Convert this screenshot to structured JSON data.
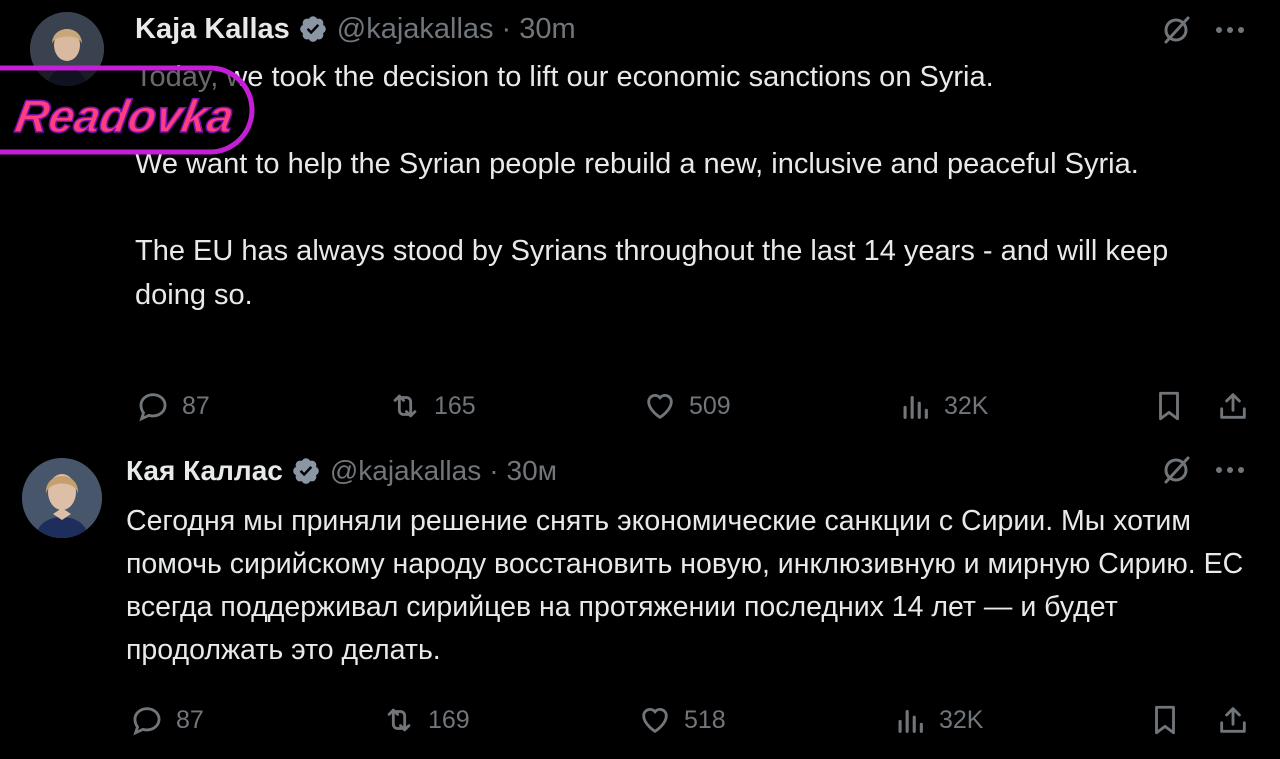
{
  "tweets": [
    {
      "author_name": "Kaja Kallas",
      "handle": "@kajakallas",
      "separator": "·",
      "time": "30m",
      "text": "Today, we took the decision to lift our economic sanctions on Syria.\n\nWe want to help the Syrian people rebuild a new, inclusive and peaceful Syria.\n\nThe EU has always stood by Syrians throughout the last 14 years - and will keep doing so.",
      "replies": "87",
      "reposts": "165",
      "likes": "509",
      "views": "32K"
    },
    {
      "author_name": "Кая Каллас",
      "handle": "@kajakallas",
      "separator": "·",
      "time": "30м",
      "text": "Сегодня мы приняли решение снять экономические санкции с Сирии. Мы хотим помочь сирийскому народу восстановить новую, инклюзивную и мирную Сирию. ЕС всегда поддерживал сирийцев на протяжении последних 14 лет — и будет продолжать это делать.",
      "replies": "87",
      "reposts": "169",
      "likes": "518",
      "views": "32K"
    }
  ],
  "watermark": {
    "text": "Readovka",
    "colors": {
      "border": "#c41ed6",
      "text": "#ff3d7f"
    }
  },
  "colors": {
    "background": "#000000",
    "text_primary": "#e7e9ea",
    "text_secondary": "#71767b",
    "verified_badge": "#1d9bf0"
  },
  "icons": [
    "verified-badge-icon",
    "grok-icon",
    "more-icon",
    "reply-icon",
    "repost-icon",
    "like-icon",
    "views-icon",
    "bookmark-icon",
    "share-icon"
  ]
}
